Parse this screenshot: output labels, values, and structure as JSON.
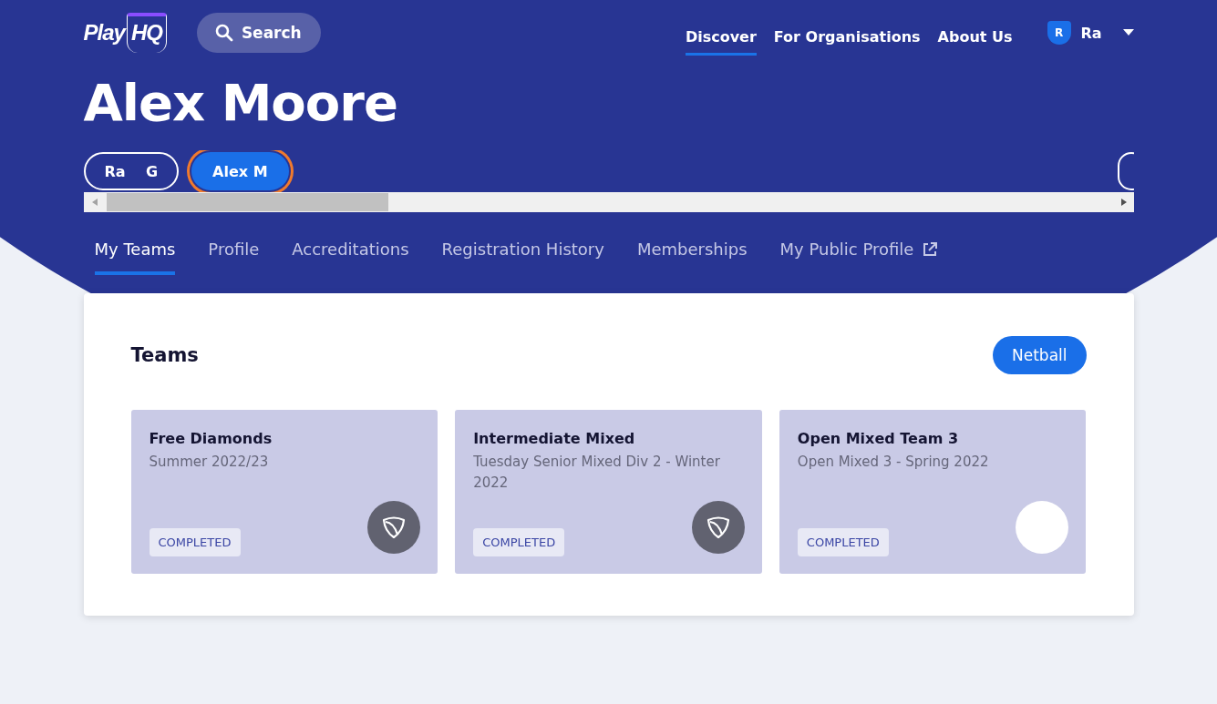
{
  "header": {
    "logo": {
      "text": "Play",
      "badge": "HQ"
    },
    "search": {
      "label": "Search"
    },
    "nav": [
      {
        "label": "Discover",
        "selected": true
      },
      {
        "label": "For Organisations",
        "selected": false
      },
      {
        "label": "About Us",
        "selected": false
      }
    ],
    "user": {
      "initial": "R",
      "name": "Ra"
    }
  },
  "page_title": "Alex Moore",
  "profiles": [
    {
      "label": "Ra    G",
      "selected": false
    },
    {
      "label": "Alex M",
      "selected": true
    },
    {
      "selected": false
    }
  ],
  "tabs": [
    {
      "label": "My Teams",
      "selected": true,
      "external": false
    },
    {
      "label": "Profile",
      "selected": false,
      "external": false
    },
    {
      "label": "Accreditations",
      "selected": false,
      "external": false
    },
    {
      "label": "Registration History",
      "selected": false,
      "external": false
    },
    {
      "label": "Memberships",
      "selected": false,
      "external": false
    },
    {
      "label": "My Public Profile",
      "selected": false,
      "external": true
    }
  ],
  "teams_panel": {
    "title": "Teams",
    "filter": "Netball",
    "teams": [
      {
        "name": "Free Diamonds",
        "season": "Summer 2022/23",
        "status": "COMPLETED",
        "kind": "shield"
      },
      {
        "name": "Intermediate Mixed",
        "season": "Tuesday Senior Mixed Div 2 - Winter 2022",
        "status": "COMPLETED",
        "kind": "shield"
      },
      {
        "name": "Open Mixed Team 3",
        "season": "Open Mixed 3 - Spring 2022",
        "status": "COMPLETED",
        "kind": "plain"
      }
    ]
  }
}
